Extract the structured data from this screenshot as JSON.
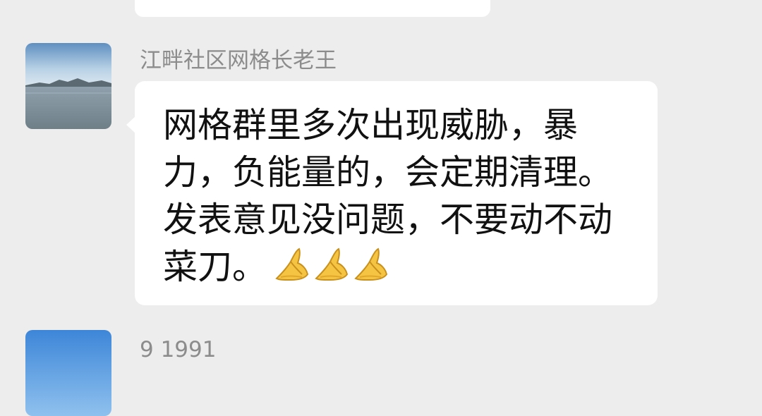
{
  "messages": [
    {
      "sender": "江畔社区网格长老王",
      "avatar": "sea-landscape-avatar",
      "text": "网格群里多次出现威胁，暴力，负能量的，会定期清理。发表意见没问题，不要动不动菜刀。",
      "emojis": [
        "palms-together-icon",
        "palms-together-icon",
        "palms-together-icon"
      ]
    },
    {
      "sender": "9 1991",
      "avatar": "blue-sky-avatar"
    }
  ],
  "colors": {
    "background": "#ededed",
    "bubble": "#ffffff",
    "sender_name": "#8c8c8c",
    "text": "#111111"
  }
}
